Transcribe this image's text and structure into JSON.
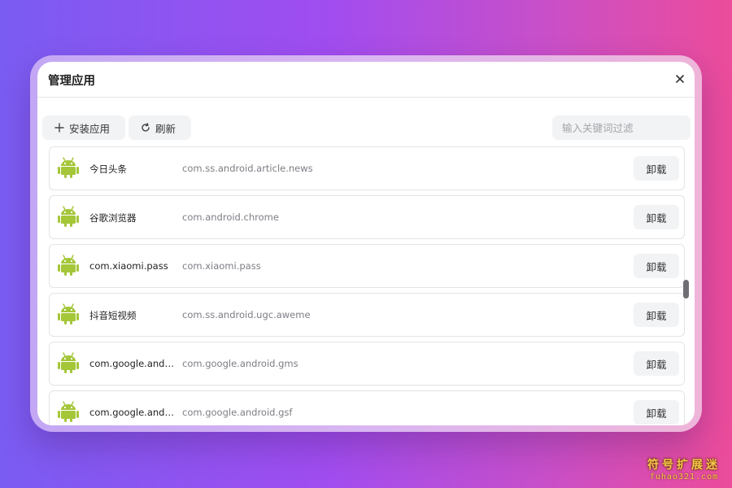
{
  "dialog": {
    "title": "管理应用",
    "close_icon": "close-icon"
  },
  "toolbar": {
    "install_label": "安装应用",
    "install_icon": "plus-icon",
    "refresh_label": "刷新",
    "refresh_icon": "refresh-icon",
    "filter_placeholder": "输入关键词过滤"
  },
  "apps": [
    {
      "name": "今日头条",
      "package": "com.ss.android.article.news",
      "action": "卸载"
    },
    {
      "name": "谷歌浏览器",
      "package": "com.android.chrome",
      "action": "卸载"
    },
    {
      "name": "com.xiaomi.pass",
      "package": "com.xiaomi.pass",
      "action": "卸载"
    },
    {
      "name": "抖音短视频",
      "package": "com.ss.android.ugc.aweme",
      "action": "卸载"
    },
    {
      "name": "com.google.andr...",
      "package": "com.google.android.gms",
      "action": "卸载"
    },
    {
      "name": "com.google.andr...",
      "package": "com.google.android.gsf",
      "action": "卸载"
    }
  ],
  "app_icon": "android-icon",
  "colors": {
    "android_green": "#a4c639",
    "button_bg": "#f2f3f5"
  },
  "watermark": {
    "title": "符号扩展迷",
    "subtitle": "fuhao321.com"
  }
}
